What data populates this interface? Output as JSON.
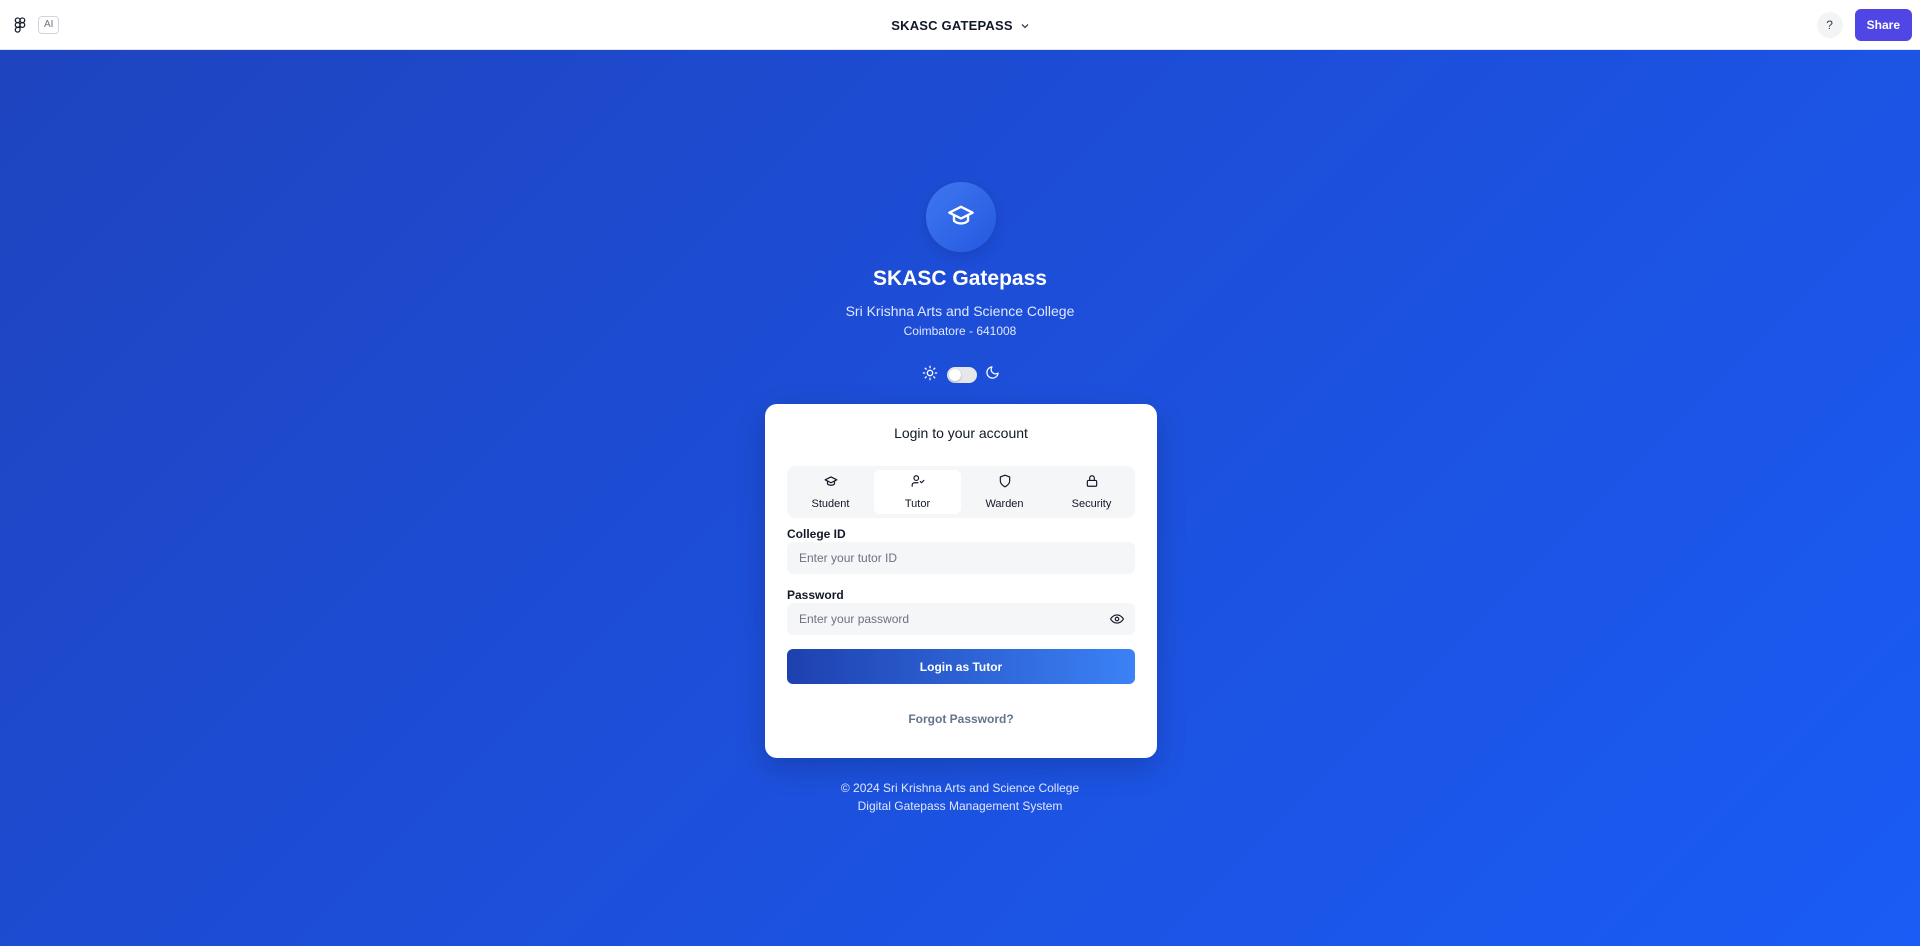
{
  "topbar": {
    "ai_badge": "AI",
    "title": "SKASC GATEPASS",
    "help_label": "?",
    "share_label": "Share"
  },
  "brand": {
    "title": "SKASC Gatepass",
    "college": "Sri Krishna Arts and Science College",
    "location": "Coimbatore - 641008"
  },
  "theme": {
    "mode": "light"
  },
  "login": {
    "heading": "Login to your account",
    "roles": [
      {
        "label": "Student",
        "icon": "graduation-cap-icon",
        "active": false
      },
      {
        "label": "Tutor",
        "icon": "user-check-icon",
        "active": true
      },
      {
        "label": "Warden",
        "icon": "shield-icon",
        "active": false
      },
      {
        "label": "Security",
        "icon": "lock-icon",
        "active": false
      }
    ],
    "college_id_label": "College ID",
    "college_id_placeholder": "Enter your tutor ID",
    "college_id_value": "",
    "password_label": "Password",
    "password_placeholder": "Enter your password",
    "password_value": "",
    "submit_label": "Login as Tutor",
    "forgot_label": "Forgot Password?"
  },
  "footer": {
    "copyright": "© 2024 Sri Krishna Arts and Science College",
    "system": "Digital Gatepass Management System"
  },
  "colors": {
    "share_button": "#4f46e5",
    "background_start": "#1e44bf",
    "background_end": "#1a5cf5",
    "login_button_start": "#1e40af",
    "login_button_end": "#3b82f6"
  }
}
